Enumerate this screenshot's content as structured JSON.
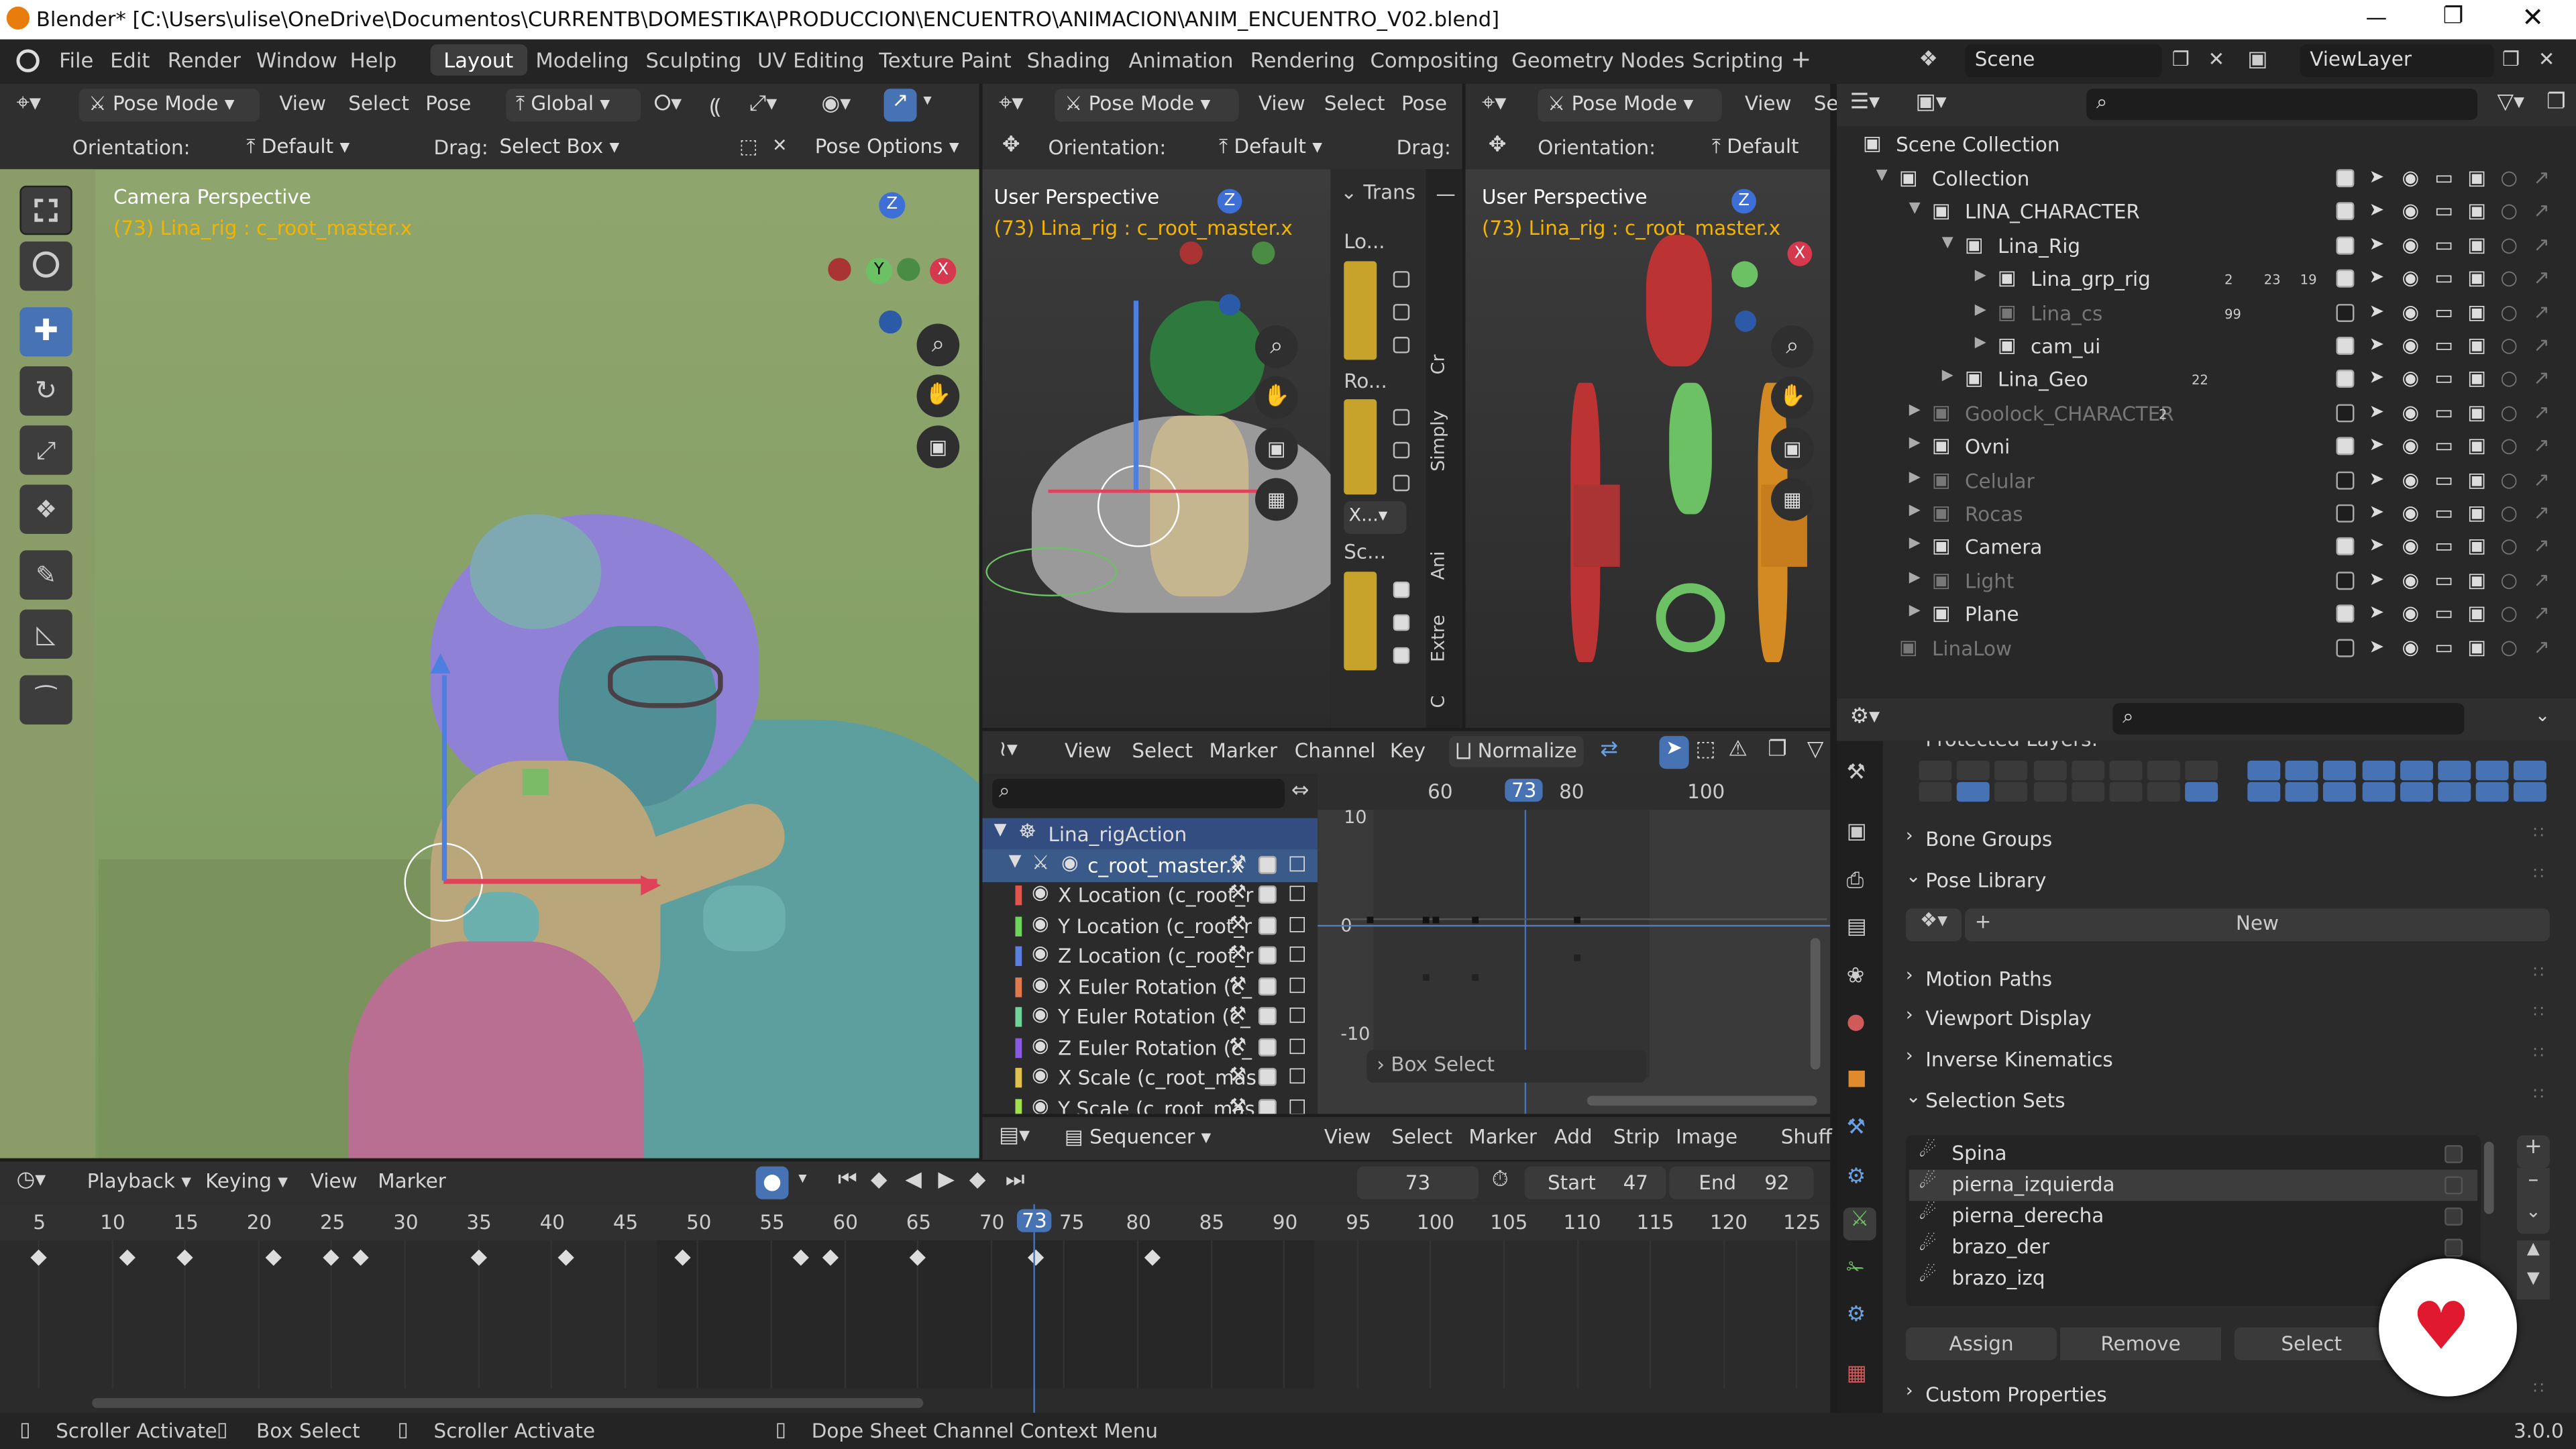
{
  "window": {
    "title": "Blender* [C:\\Users\\ulise\\OneDrive\\Documentos\\CURRENTB\\DOMESTIKA\\PRODUCCION\\ENCUENTRO\\ANIMACION\\ANIM_ENCUENTRO_V02.blend]"
  },
  "menu": {
    "items": [
      "File",
      "Edit",
      "Render",
      "Window",
      "Help"
    ]
  },
  "workspaces": {
    "items": [
      "Layout",
      "Modeling",
      "Sculpting",
      "UV Editing",
      "Texture Paint",
      "Shading",
      "Animation",
      "Rendering",
      "Compositing",
      "Geometry Nodes",
      "Scripting"
    ],
    "active": "Layout"
  },
  "scene": {
    "name": "Scene",
    "view_layer": "ViewLayer"
  },
  "viewport_main": {
    "mode": "Pose Mode",
    "menus": [
      "View",
      "Select",
      "Pose"
    ],
    "transform": "Global",
    "orientation_label": "Orientation:",
    "orientation": "Default",
    "drag_label": "Drag:",
    "drag": "Select Box",
    "pose_options": "Pose Options",
    "overlay_title": "Camera Perspective",
    "overlay_sub": "(73) Lina_rig : c_root_master.x"
  },
  "viewport_2": {
    "mode": "Pose Mode",
    "menus": [
      "View",
      "Select",
      "Pose"
    ],
    "orientation_label": "Orientation:",
    "orientation": "Default",
    "drag_label": "Drag:",
    "overlay_title": "User Perspective",
    "overlay_sub": "(73) Lina_rig : c_root_master.x",
    "npanel_title": "Trans",
    "npanel_loc": "Lo...",
    "npanel_rot": "Ro...",
    "npanel_rotmode": "X...",
    "npanel_scale": "Sc...",
    "tabs": [
      "Cr",
      "Simply",
      "Ani",
      "Extre",
      "C"
    ]
  },
  "viewport_3": {
    "mode": "Pose Mode",
    "menus": [
      "View",
      "Se"
    ],
    "orientation_label": "Orientation:",
    "orientation": "Default",
    "overlay_title": "User Perspective",
    "overlay_sub": "(73) Lina_rig : c_root_master.x"
  },
  "outliner": {
    "root": "Scene Collection",
    "items": [
      {
        "label": "Collection",
        "indent": 1
      },
      {
        "label": "LINA_CHARACTER",
        "indent": 2
      },
      {
        "label": "Lina_Rig",
        "indent": 3
      },
      {
        "label": "Lina_grp_rig",
        "indent": 4,
        "badge1": "2",
        "badge2": "23",
        "badge3": "19"
      },
      {
        "label": "Lina_cs",
        "indent": 4,
        "dim": true,
        "badge1": "99"
      },
      {
        "label": "cam_ui",
        "indent": 4
      },
      {
        "label": "Lina_Geo",
        "indent": 3,
        "badge1": "22"
      },
      {
        "label": "Goolock_CHARACTER",
        "indent": 2,
        "dim": true,
        "badge1": "2"
      },
      {
        "label": "Ovni",
        "indent": 2
      },
      {
        "label": "Celular",
        "indent": 2,
        "dim": true
      },
      {
        "label": "Rocas",
        "indent": 2,
        "dim": true
      },
      {
        "label": "Camera",
        "indent": 2
      },
      {
        "label": "Light",
        "indent": 2,
        "dim": true
      },
      {
        "label": "Plane",
        "indent": 2
      },
      {
        "label": "LinaLow",
        "indent": 1,
        "dim": true
      }
    ]
  },
  "properties": {
    "protected_layers": "Protected Layers:",
    "sections": [
      "Bone Groups",
      "Pose Library",
      "Motion Paths",
      "Viewport Display",
      "Inverse Kinematics",
      "Selection Sets",
      "Custom Properties"
    ],
    "new_label": "New",
    "selection_sets": [
      "Spina",
      "pierna_izquierda",
      "pierna_derecha",
      "brazo_der",
      "brazo_izq"
    ],
    "assign": "Assign",
    "remove": "Remove",
    "select": "Select"
  },
  "graph": {
    "menus": [
      "View",
      "Select",
      "Marker",
      "Channel",
      "Key"
    ],
    "normalize": "Normalize",
    "action": "Lina_rigAction",
    "bone": "c_root_master.x",
    "channels": [
      {
        "label": "X Location (c_root_r",
        "color": "#e0564e"
      },
      {
        "label": "Y Location (c_root_r",
        "color": "#6ed45c"
      },
      {
        "label": "Z Location (c_root_r",
        "color": "#5a7fe0"
      },
      {
        "label": "X Euler Rotation (c_",
        "color": "#e07a4e"
      },
      {
        "label": "Y Euler Rotation (c_",
        "color": "#6ed49a"
      },
      {
        "label": "Z Euler Rotation (c_",
        "color": "#8a5ae0"
      },
      {
        "label": "X Scale (c_root_mas",
        "color": "#e0c04e"
      },
      {
        "label": "Y Scale (c_root_mas",
        "color": "#a0e04e"
      }
    ],
    "frame_ticks": [
      "60",
      "73",
      "80",
      "100"
    ],
    "value_ticks": [
      "10",
      "0",
      "-10"
    ],
    "box_select": "Box Select"
  },
  "sequencer": {
    "title": "Sequencer",
    "menus": [
      "View",
      "Select",
      "Marker",
      "Add",
      "Strip",
      "Image",
      "Shuff"
    ]
  },
  "timeline": {
    "menus": [
      "Playback",
      "Keying",
      "View",
      "Marker"
    ],
    "current_frame": "73",
    "start_label": "Start",
    "start": "47",
    "end_label": "End",
    "end": "92",
    "ticks": [
      "5",
      "10",
      "15",
      "20",
      "25",
      "30",
      "35",
      "40",
      "45",
      "50",
      "55",
      "60",
      "65",
      "70",
      "75",
      "80",
      "85",
      "90",
      "95",
      "100",
      "105",
      "110",
      "115",
      "120",
      "125"
    ],
    "keyframes": [
      5,
      11,
      15,
      21,
      25,
      27,
      35,
      41,
      49,
      57,
      59,
      65,
      73,
      81
    ]
  },
  "status": {
    "items": [
      "Scroller Activate",
      "Box Select",
      "Scroller Activate",
      "Dope Sheet Channel Context Menu"
    ],
    "version": "3.0.0"
  }
}
